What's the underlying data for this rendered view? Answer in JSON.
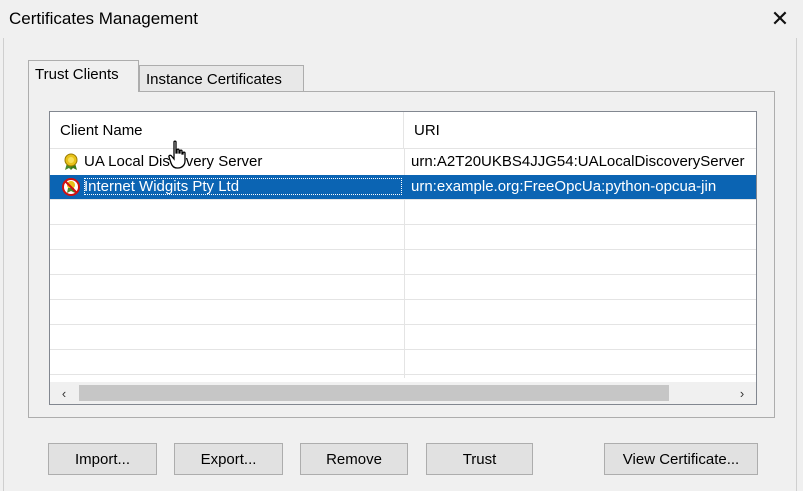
{
  "window": {
    "title": "Certificates Management",
    "close_glyph": "✕"
  },
  "tabs": [
    {
      "label": "Trust Clients",
      "active": true
    },
    {
      "label": "Instance Certificates",
      "active": false
    }
  ],
  "table": {
    "columns": [
      "Client Name",
      "URI"
    ],
    "rows": [
      {
        "name": "UA Local Discovery Server",
        "uri": "urn:A2T20UKBS4JJG54:UALocalDiscoveryServer",
        "icon": "certificate-trusted-icon",
        "selected": false
      },
      {
        "name": "Internet Widgits Pty Ltd",
        "uri": "urn:example.org:FreeOpcUa:python-opcua-jin",
        "icon": "certificate-untrusted-icon",
        "selected": true
      }
    ]
  },
  "scrollbar": {
    "left_glyph": "‹",
    "right_glyph": "›"
  },
  "buttons": {
    "import": "Import...",
    "export": "Export...",
    "remove": "Remove",
    "trust": "Trust",
    "view": "View Certificate..."
  },
  "colors": {
    "selection": "#0b64b3",
    "background": "#f0f0f0"
  }
}
